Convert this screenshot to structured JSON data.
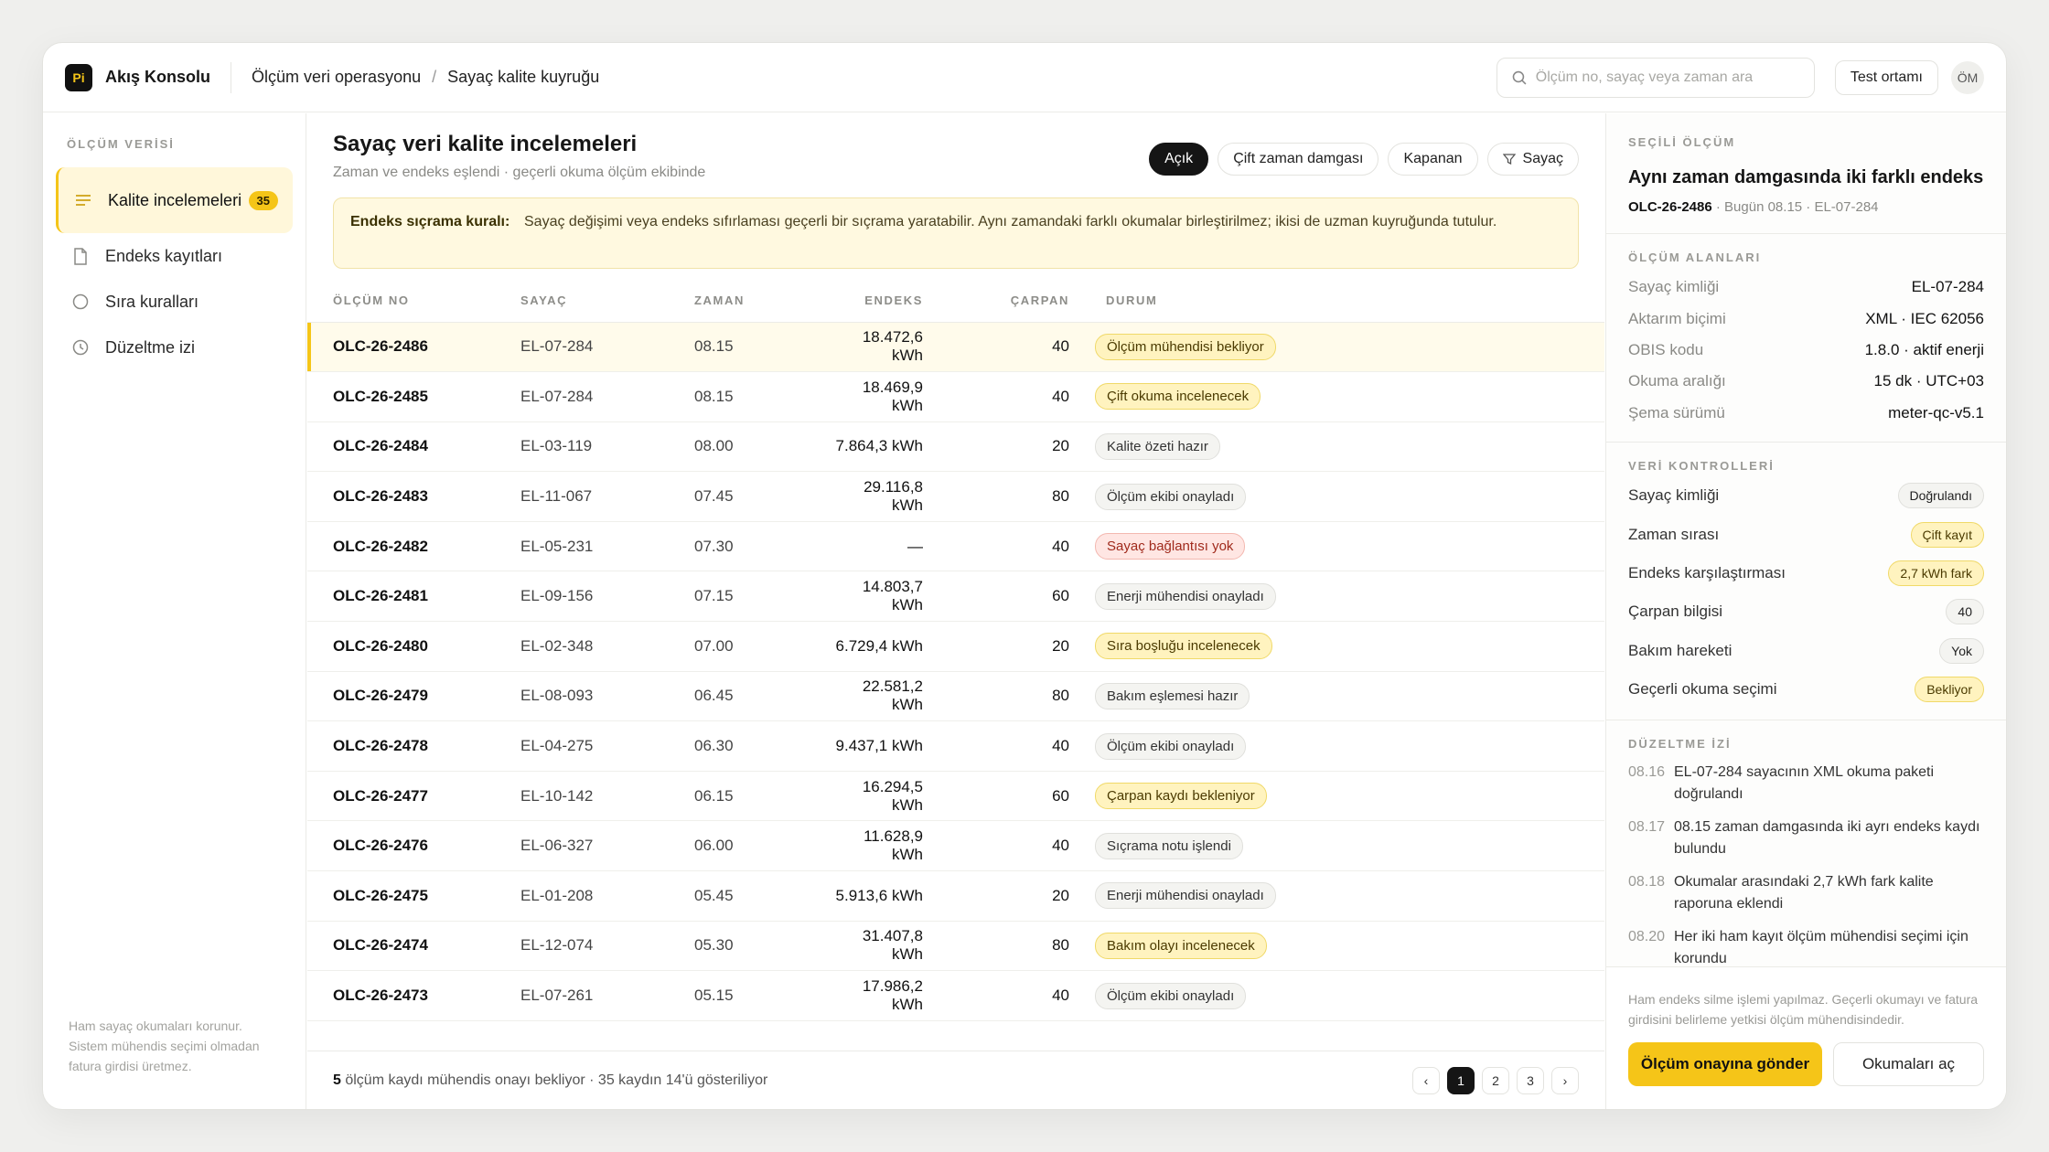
{
  "header": {
    "logo_text": "Pi",
    "app_title": "Akış Konsolu",
    "breadcrumb": [
      "Ölçüm veri operasyonu",
      "Sayaç kalite kuyruğu"
    ],
    "breadcrumb_sep": "/",
    "search_placeholder": "Ölçüm no, sayaç veya zaman ara",
    "env_label": "Test ortamı",
    "avatar": "ÖM"
  },
  "sidebar": {
    "section": "ÖLÇÜM VERİSİ",
    "items": [
      {
        "label": "Kalite incelemeleri",
        "badge": "35",
        "icon": "list-icon"
      },
      {
        "label": "Endeks kayıtları",
        "icon": "document-icon"
      },
      {
        "label": "Sıra kuralları",
        "icon": "shield-icon"
      },
      {
        "label": "Düzeltme izi",
        "icon": "clock-icon"
      }
    ],
    "note": "Ham sayaç okumaları korunur. Sistem mühendis seçimi olmadan fatura girdisi üretmez."
  },
  "main": {
    "title": "Sayaç veri kalite incelemeleri",
    "subtitle": "Zaman ve endeks eşlendi · geçerli okuma ölçüm ekibinde",
    "filters": [
      "Açık",
      "Çift zaman damgası",
      "Kapanan",
      "Sayaç"
    ],
    "rule_label": "Endeks sıçrama kuralı:",
    "rule_text": "Sayaç değişimi veya endeks sıfırlaması geçerli bir sıçrama yaratabilir. Aynı zamandaki farklı okumalar birleştirilmez; ikisi de uzman kuyruğunda tutulur.",
    "columns": [
      "ÖLÇÜM NO",
      "SAYAÇ",
      "ZAMAN",
      "ENDEKS",
      "ÇARPAN",
      "DURUM"
    ],
    "rows": [
      {
        "id": "OLC-26-2486",
        "meter": "EL-07-284",
        "time": "08.15",
        "index": "18.472,6 kWh",
        "mult": "40",
        "status": "Ölçüm mühendisi bekliyor",
        "tone": "warn"
      },
      {
        "id": "OLC-26-2485",
        "meter": "EL-07-284",
        "time": "08.15",
        "index": "18.469,9 kWh",
        "mult": "40",
        "status": "Çift okuma incelenecek",
        "tone": "warn"
      },
      {
        "id": "OLC-26-2484",
        "meter": "EL-03-119",
        "time": "08.00",
        "index": "7.864,3 kWh",
        "mult": "20",
        "status": "Kalite özeti hazır",
        "tone": "neutral"
      },
      {
        "id": "OLC-26-2483",
        "meter": "EL-11-067",
        "time": "07.45",
        "index": "29.116,8 kWh",
        "mult": "80",
        "status": "Ölçüm ekibi onayladı",
        "tone": "neutral"
      },
      {
        "id": "OLC-26-2482",
        "meter": "EL-05-231",
        "time": "07.30",
        "index": "—",
        "mult": "40",
        "status": "Sayaç bağlantısı yok",
        "tone": "err"
      },
      {
        "id": "OLC-26-2481",
        "meter": "EL-09-156",
        "time": "07.15",
        "index": "14.803,7 kWh",
        "mult": "60",
        "status": "Enerji mühendisi onayladı",
        "tone": "neutral"
      },
      {
        "id": "OLC-26-2480",
        "meter": "EL-02-348",
        "time": "07.00",
        "index": "6.729,4 kWh",
        "mult": "20",
        "status": "Sıra boşluğu incelenecek",
        "tone": "warn"
      },
      {
        "id": "OLC-26-2479",
        "meter": "EL-08-093",
        "time": "06.45",
        "index": "22.581,2 kWh",
        "mult": "80",
        "status": "Bakım eşlemesi hazır",
        "tone": "neutral"
      },
      {
        "id": "OLC-26-2478",
        "meter": "EL-04-275",
        "time": "06.30",
        "index": "9.437,1 kWh",
        "mult": "40",
        "status": "Ölçüm ekibi onayladı",
        "tone": "neutral"
      },
      {
        "id": "OLC-26-2477",
        "meter": "EL-10-142",
        "time": "06.15",
        "index": "16.294,5 kWh",
        "mult": "60",
        "status": "Çarpan kaydı bekleniyor",
        "tone": "warn"
      },
      {
        "id": "OLC-26-2476",
        "meter": "EL-06-327",
        "time": "06.00",
        "index": "11.628,9 kWh",
        "mult": "40",
        "status": "Sıçrama notu işlendi",
        "tone": "neutral"
      },
      {
        "id": "OLC-26-2475",
        "meter": "EL-01-208",
        "time": "05.45",
        "index": "5.913,6 kWh",
        "mult": "20",
        "status": "Enerji mühendisi onayladı",
        "tone": "neutral"
      },
      {
        "id": "OLC-26-2474",
        "meter": "EL-12-074",
        "time": "05.30",
        "index": "31.407,8 kWh",
        "mult": "80",
        "status": "Bakım olayı incelenecek",
        "tone": "warn"
      },
      {
        "id": "OLC-26-2473",
        "meter": "EL-07-261",
        "time": "05.15",
        "index": "17.986,2 kWh",
        "mult": "40",
        "status": "Ölçüm ekibi onayladı",
        "tone": "neutral"
      }
    ],
    "footer_count": "5",
    "footer_text": " ölçüm kaydı mühendis onayı bekliyor · 35 kaydın 14'ü gösteriliyor",
    "pages": [
      "1",
      "2",
      "3"
    ],
    "prev": "‹",
    "next": "›"
  },
  "panel": {
    "section": "SEÇİLİ ÖLÇÜM",
    "title": "Aynı zaman damgasında iki farklı endeks",
    "meta_id": "OLC-26-2486",
    "meta_rest": " · Bugün 08.15 · EL-07-284",
    "fields_label": "ÖLÇÜM ALANLARI",
    "fields": [
      {
        "k": "Sayaç kimliği",
        "v": "EL-07-284"
      },
      {
        "k": "Aktarım biçimi",
        "v": "XML · IEC 62056"
      },
      {
        "k": "OBIS kodu",
        "v": "1.8.0 · aktif enerji"
      },
      {
        "k": "Okuma aralığı",
        "v": "15 dk · UTC+03"
      },
      {
        "k": "Şema sürümü",
        "v": "meter-qc-v5.1"
      }
    ],
    "checks_label": "VERİ KONTROLLERİ",
    "checks": [
      {
        "k": "Sayaç kimliği",
        "v": "Doğrulandı",
        "tone": "neutral"
      },
      {
        "k": "Zaman sırası",
        "v": "Çift kayıt",
        "tone": "warn"
      },
      {
        "k": "Endeks karşılaştırması",
        "v": "2,7 kWh fark",
        "tone": "warn"
      },
      {
        "k": "Çarpan bilgisi",
        "v": "40",
        "tone": "neutral"
      },
      {
        "k": "Bakım hareketi",
        "v": "Yok",
        "tone": "neutral"
      },
      {
        "k": "Geçerli okuma seçimi",
        "v": "Bekliyor",
        "tone": "warn"
      }
    ],
    "log_label": "DÜZELTME İZİ",
    "log": [
      {
        "t": "08.16",
        "text": "EL-07-284 sayacının XML okuma paketi doğrulandı"
      },
      {
        "t": "08.17",
        "text": "08.15 zaman damgasında iki ayrı endeks kaydı bulundu"
      },
      {
        "t": "08.18",
        "text": "Okumalar arasındaki 2,7 kWh fark kalite raporuna eklendi"
      },
      {
        "t": "08.20",
        "text": "Her iki ham kayıt ölçüm mühendisi seçimi için korundu"
      }
    ],
    "footer_note": "Ham endeks silme işlemi yapılmaz. Geçerli okumayı ve fatura girdisini belirleme yetkisi ölçüm mühendisindedir.",
    "primary_btn": "Ölçüm onayına gönder",
    "secondary_btn": "Okumaları aç"
  }
}
